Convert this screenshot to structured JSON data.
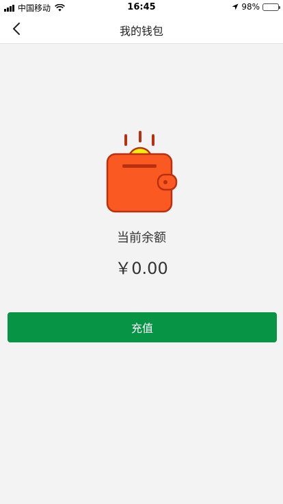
{
  "status_bar": {
    "carrier": "中国移动",
    "time": "16:45",
    "battery_percent": "98%",
    "battery_level": 0.98,
    "colors": {
      "battery_fill": "#4cd964"
    }
  },
  "nav": {
    "title": "我的钱包",
    "back_icon": "chevron-left-icon"
  },
  "wallet": {
    "icon": "wallet-icon",
    "balance_label": "当前余额",
    "balance_value": "￥0.00"
  },
  "actions": {
    "recharge_label": "充值"
  },
  "colors": {
    "primary": "#079545",
    "background": "#f3f3f3",
    "wallet_body": "#fa5a22",
    "wallet_outline": "#b93010",
    "coin": "#f6ee10"
  }
}
